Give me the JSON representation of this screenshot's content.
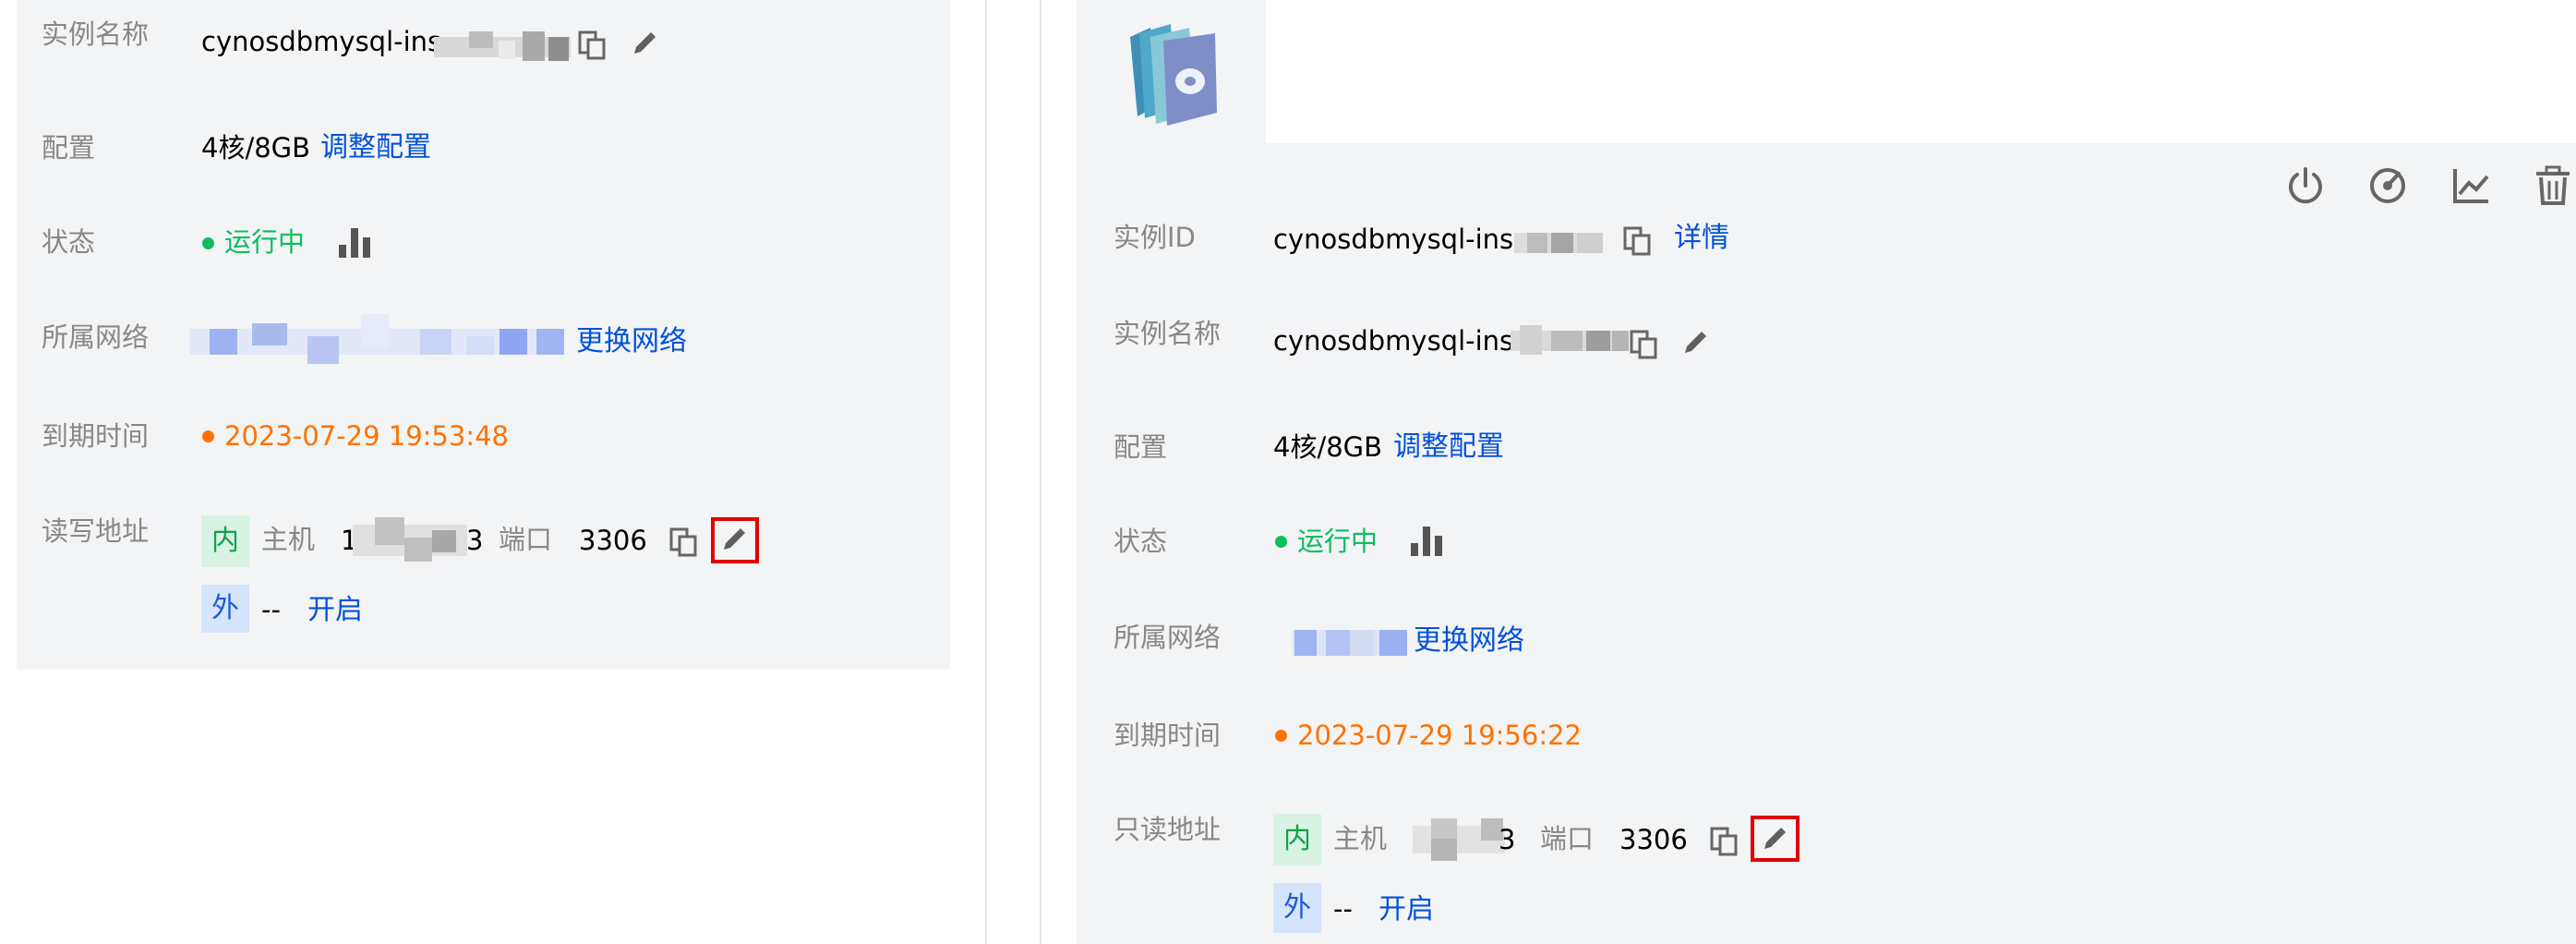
{
  "left": {
    "instance_name": {
      "label": "实例名称",
      "value": "cynosdbmysql-ins-"
    },
    "config": {
      "label": "配置",
      "value": "4核/8GB",
      "action": "调整配置"
    },
    "status": {
      "label": "状态",
      "value": "运行中"
    },
    "network": {
      "label": "所属网络",
      "action": "更换网络"
    },
    "expire": {
      "label": "到期时间",
      "value": "2023-07-29 19:53:48"
    },
    "address": {
      "label": "读写地址",
      "inner_tag": "内",
      "host_label": "主机",
      "host_prefix": "1",
      "host_suffix": "3",
      "port_label": "端口",
      "port": "3306",
      "outer_tag": "外",
      "outer_value": "--",
      "outer_action": "开启"
    }
  },
  "right": {
    "instance_id": {
      "label": "实例ID",
      "value": "cynosdbmysql-ins-",
      "action": "详情"
    },
    "instance_name": {
      "label": "实例名称",
      "value": "cynosdbmysql-ins-"
    },
    "config": {
      "label": "配置",
      "value": "4核/8GB",
      "action": "调整配置"
    },
    "status": {
      "label": "状态",
      "value": "运行中"
    },
    "network": {
      "label": "所属网络",
      "action": "更换网络"
    },
    "expire": {
      "label": "到期时间",
      "value": "2023-07-29 19:56:22"
    },
    "address": {
      "label": "只读地址",
      "inner_tag": "内",
      "host_label": "主机",
      "host_suffix": "3",
      "port_label": "端口",
      "port": "3306",
      "outer_tag": "外",
      "outer_value": "--",
      "outer_action": "开启"
    },
    "toolbar_icons": [
      "power-icon",
      "speed-icon",
      "line-chart-icon",
      "trash-icon"
    ]
  },
  "colors": {
    "panel_bg": "#f3f4f6",
    "label": "#888888",
    "link": "#0052d9",
    "running": "#0abf5b",
    "expire": "#ff7200",
    "highlight": "#e00000"
  }
}
